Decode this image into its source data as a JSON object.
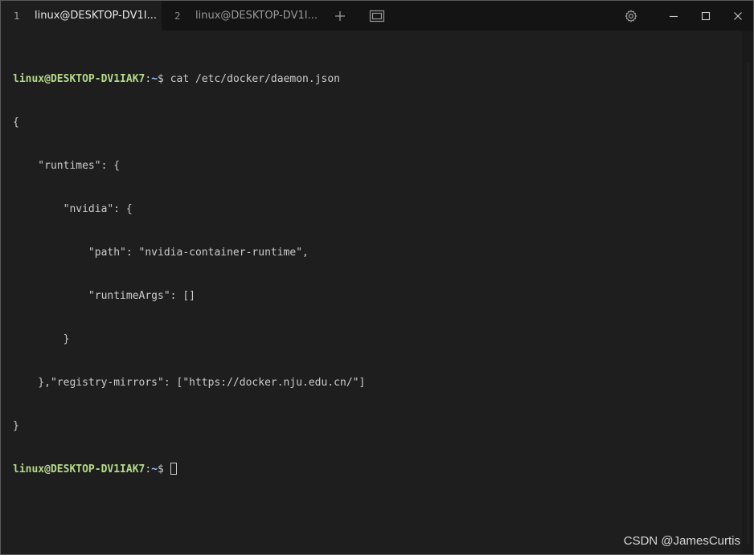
{
  "tabs": [
    {
      "number": "1",
      "title": "linux@DESKTOP-DV1I..."
    },
    {
      "number": "2",
      "title": "linux@DESKTOP-DV1I..."
    }
  ],
  "titlebar_icons": [
    "plus-icon",
    "tab-overview-icon",
    "gear-icon",
    "minimize-icon",
    "maximize-icon",
    "close-icon"
  ],
  "terminal": {
    "prompt_user": "linux@DESKTOP-DV1IAK7",
    "prompt_colon": ":",
    "prompt_path": "~",
    "prompt_symbol": "$ ",
    "command": "cat /etc/docker/daemon.json",
    "output_lines": [
      "{",
      "    \"runtimes\": {",
      "        \"nvidia\": {",
      "            \"path\": \"nvidia-container-runtime\",",
      "            \"runtimeArgs\": []",
      "        }",
      "    },\"registry-mirrors\": [\"https://docker.nju.edu.cn/\"]",
      "}"
    ]
  },
  "watermark": "CSDN @JamesCurtis",
  "colors": {
    "background": "#1e1e1e",
    "titlebar": "#141414",
    "prompt_user": "#b5d98a",
    "prompt_path": "#9cc2ff"
  }
}
